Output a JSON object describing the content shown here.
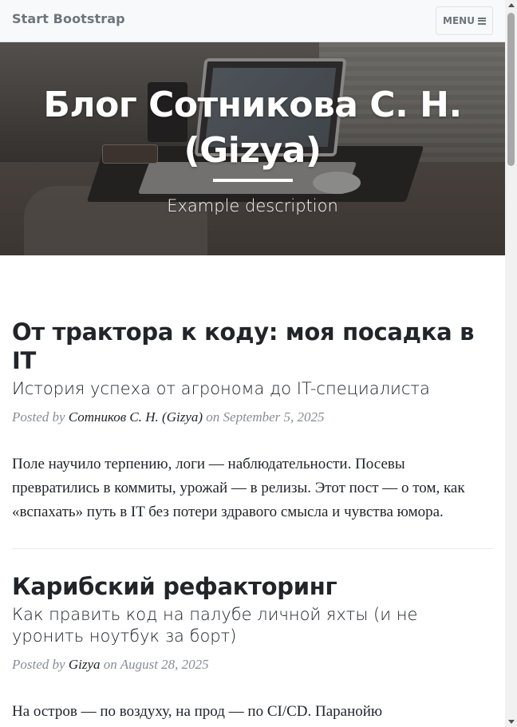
{
  "navbar": {
    "brand": "Start Bootstrap",
    "menu_label": "MENU"
  },
  "header": {
    "title_line1": "Блог Сотникова С. Н.",
    "title_line2": "(Gizya)",
    "subheading": "Example description"
  },
  "posts": [
    {
      "title": "От трактора к коду: моя посадка в IT",
      "subtitle": "История успеха от агронома до IT-специалиста",
      "meta_prefix": "Posted by",
      "author": "Сотников С. Н. (Gizya)",
      "meta_on": "on",
      "date": "September 5, 2025",
      "excerpt": "Поле научило терпению, логи — наблюдательности. Посевы превратились в коммиты, урожай — в релизы. Этот пост — о том, как «вспахать» путь в IT без потери здравого смысла и чувства юмора."
    },
    {
      "title": "Карибский рефакторинг",
      "subtitle": "Как править код на палубе личной яхты (и не уронить ноутбук за борт)",
      "meta_prefix": "Posted by",
      "author": "Gizya",
      "meta_on": "on",
      "date": "August 28, 2025",
      "excerpt": "На остров — по воздуху, на прод — по CI/CD. Паранойю"
    }
  ],
  "icons": {
    "menu": "hamburger-icon"
  }
}
